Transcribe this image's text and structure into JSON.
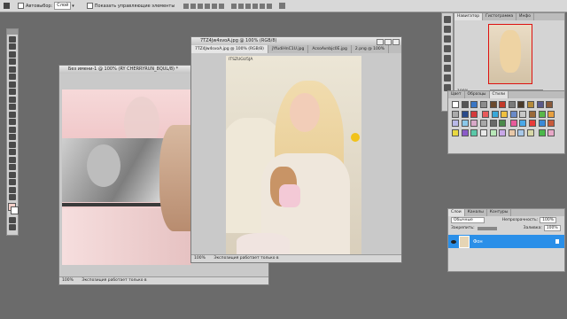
{
  "options_bar": {
    "auto_select_label": "Автовыбор:",
    "layer_select_value": "Слой",
    "show_controls_label": "Показать управляющие элементы"
  },
  "doc_back": {
    "title": "Без имени-1 @ 100% (RY CHERRYRUN_8QUL/8) *",
    "zoom": "100%",
    "status": "Экспозиция работает только в"
  },
  "doc_front": {
    "title": "7TZ4Jw4svoA.jpg @ 100% (RGB/8)",
    "tabs": [
      "7TZ4Jw4svoA.jpg @ 100% (RGB/8)",
      "jYfudiHnC1U.jpg",
      "AcsoAvnbjc0E.jpg",
      "2.png @ 100%"
    ],
    "watermark": "ITSZUGU5JA",
    "zoom": "100%",
    "status": "Экспозиция работает только в"
  },
  "navigator": {
    "tabs": [
      "Навигатор",
      "Гистограмма",
      "Инфо"
    ],
    "zoom": "100%"
  },
  "styles_panel": {
    "tabs": [
      "Цвет",
      "Образцы",
      "Стили"
    ]
  },
  "layers_panel": {
    "tabs": [
      "Слои",
      "Каналы",
      "Контуры"
    ],
    "blend_mode": "Обычные",
    "opacity_label": "Непрозрачность:",
    "opacity_value": "100%",
    "lock_label": "Закрепить:",
    "fill_label": "Заливка:",
    "fill_value": "100%",
    "layer_name": "Фон"
  },
  "colors": {
    "accent_blue": "#2a8fe8",
    "pink_bg": "#f3cfd0",
    "canvas_gray": "#6b6b6b"
  }
}
